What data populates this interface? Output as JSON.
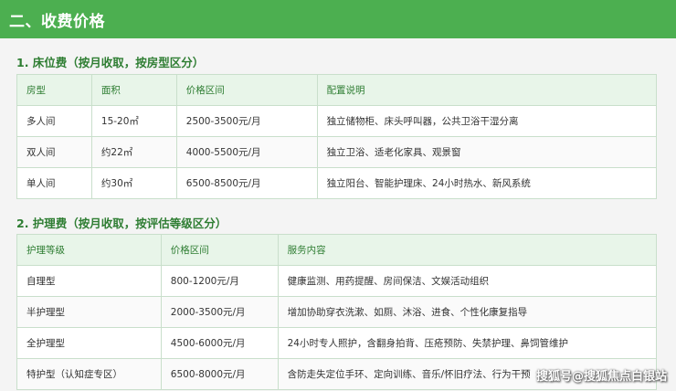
{
  "header": {
    "title": "二、收费价格"
  },
  "bed_fee": {
    "title": "1. 床位费（按月收取，按房型区分）",
    "columns": [
      "房型",
      "面积",
      "价格区间",
      "配置说明"
    ],
    "rows": [
      [
        "多人间",
        "15-20㎡",
        "2500-3500元/月",
        "独立储物柜、床头呼叫器，公共卫浴干湿分离"
      ],
      [
        "双人间",
        "约22㎡",
        "4000-5500元/月",
        "独立卫浴、适老化家具、观景窗"
      ],
      [
        "单人间",
        "约30㎡",
        "6500-8500元/月",
        "独立阳台、智能护理床、24小时热水、新风系统"
      ]
    ]
  },
  "care_fee": {
    "title": "2. 护理费（按月收取，按评估等级区分）",
    "columns": [
      "护理等级",
      "价格区间",
      "服务内容"
    ],
    "rows": [
      [
        "自理型",
        "800-1200元/月",
        "健康监测、用药提醒、房间保洁、文娱活动组织"
      ],
      [
        "半护理型",
        "2000-3500元/月",
        "增加协助穿衣洗漱、如厕、沐浴、进食、个性化康复指导"
      ],
      [
        "全护理型",
        "4500-6000元/月",
        "24小时专人照护，含翻身拍背、压疮预防、失禁护理、鼻饲管维护"
      ],
      [
        "特护型（认知症专区）",
        "6500-8000元/月",
        "含防走失定位手环、定向训练、音乐/怀旧疗法、行为干预"
      ]
    ]
  },
  "watermark": {
    "text": "搜狐号@搜狐焦点白银站"
  },
  "colors": {
    "accent": "#4caf50",
    "heading_text": "#2e7d32",
    "table_header_bg": "#e8f5e9"
  }
}
